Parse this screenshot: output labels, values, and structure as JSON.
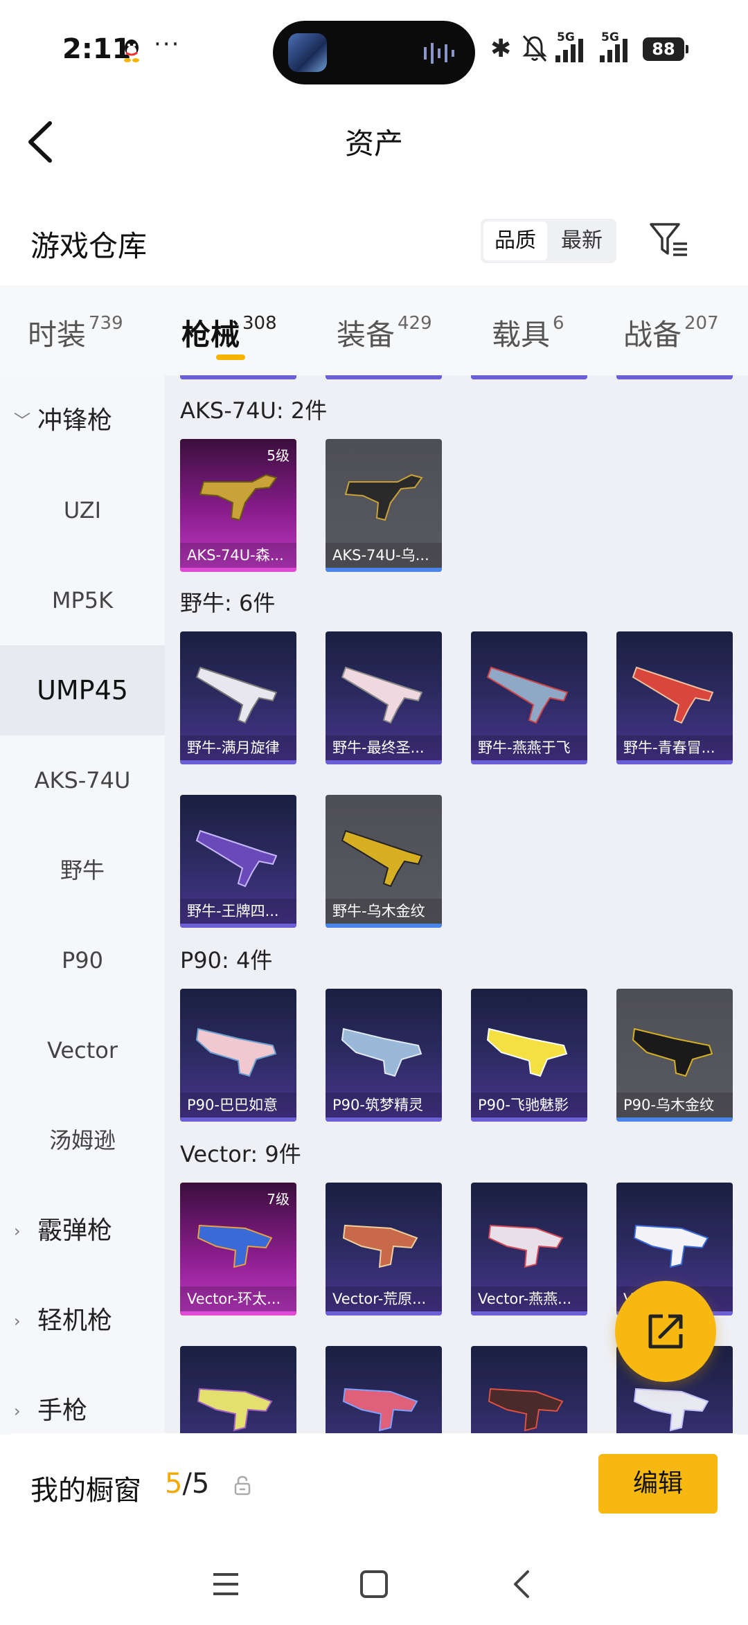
{
  "status_bar": {
    "time": "2:11",
    "more": "···",
    "network_1": "5G",
    "network_2": "5G",
    "battery": "88"
  },
  "header": {
    "title": "资产"
  },
  "warehouse": {
    "title": "游戏仓库",
    "sort_options": [
      "品质",
      "最新"
    ],
    "active_sort": "品质"
  },
  "category_tabs": [
    {
      "name": "时装",
      "count": "739"
    },
    {
      "name": "枪械",
      "count": "308"
    },
    {
      "name": "装备",
      "count": "429"
    },
    {
      "name": "载具",
      "count": "6"
    },
    {
      "name": "战备",
      "count": "207"
    }
  ],
  "active_category": "枪械",
  "sidebar": {
    "group_open": "冲锋枪",
    "items": [
      "UZI",
      "MP5K",
      "UMP45",
      "AKS-74U",
      "野牛",
      "P90",
      "Vector",
      "汤姆逊"
    ],
    "active_item": "UMP45",
    "groups_closed": [
      "霰弹枪",
      "轻机枪",
      "手枪"
    ]
  },
  "sections": [
    {
      "title": "AKS-74U: 2件",
      "cards": [
        {
          "name": "AKS-74U-森...",
          "level": "5级",
          "rarity": "pink"
        },
        {
          "name": "AKS-74U-乌...",
          "rarity": "gray"
        }
      ]
    },
    {
      "title": "野牛: 6件",
      "cards": [
        {
          "name": "野牛-满月旋律",
          "rarity": "purple"
        },
        {
          "name": "野牛-最终圣...",
          "rarity": "purple"
        },
        {
          "name": "野牛-燕燕于飞",
          "rarity": "purple"
        },
        {
          "name": "野牛-青春冒...",
          "rarity": "purple"
        },
        {
          "name": "野牛-王牌四...",
          "rarity": "purple"
        },
        {
          "name": "野牛-乌木金纹",
          "rarity": "gray"
        }
      ]
    },
    {
      "title": "P90: 4件",
      "cards": [
        {
          "name": "P90-巴巴如意",
          "rarity": "purple"
        },
        {
          "name": "P90-筑梦精灵",
          "rarity": "purple"
        },
        {
          "name": "P90-飞驰魅影",
          "rarity": "purple"
        },
        {
          "name": "P90-乌木金纹",
          "rarity": "gray"
        }
      ]
    },
    {
      "title": "Vector: 9件",
      "cards": [
        {
          "name": "Vector-环太...",
          "level": "7级",
          "rarity": "pink"
        },
        {
          "name": "Vector-荒原...",
          "rarity": "purple"
        },
        {
          "name": "Vector-燕燕...",
          "rarity": "purple"
        },
        {
          "name": "Vector-...",
          "rarity": "purple"
        }
      ]
    }
  ],
  "showcase": {
    "label": "我的橱窗",
    "count": "5",
    "total": "/5",
    "edit_label": "编辑"
  },
  "colors": {
    "accent": "#f7b90f",
    "purple_stripe": "#6b5fd8",
    "pink_stripe": "#e04bd6",
    "gray_stripe": "#4a86e8"
  }
}
